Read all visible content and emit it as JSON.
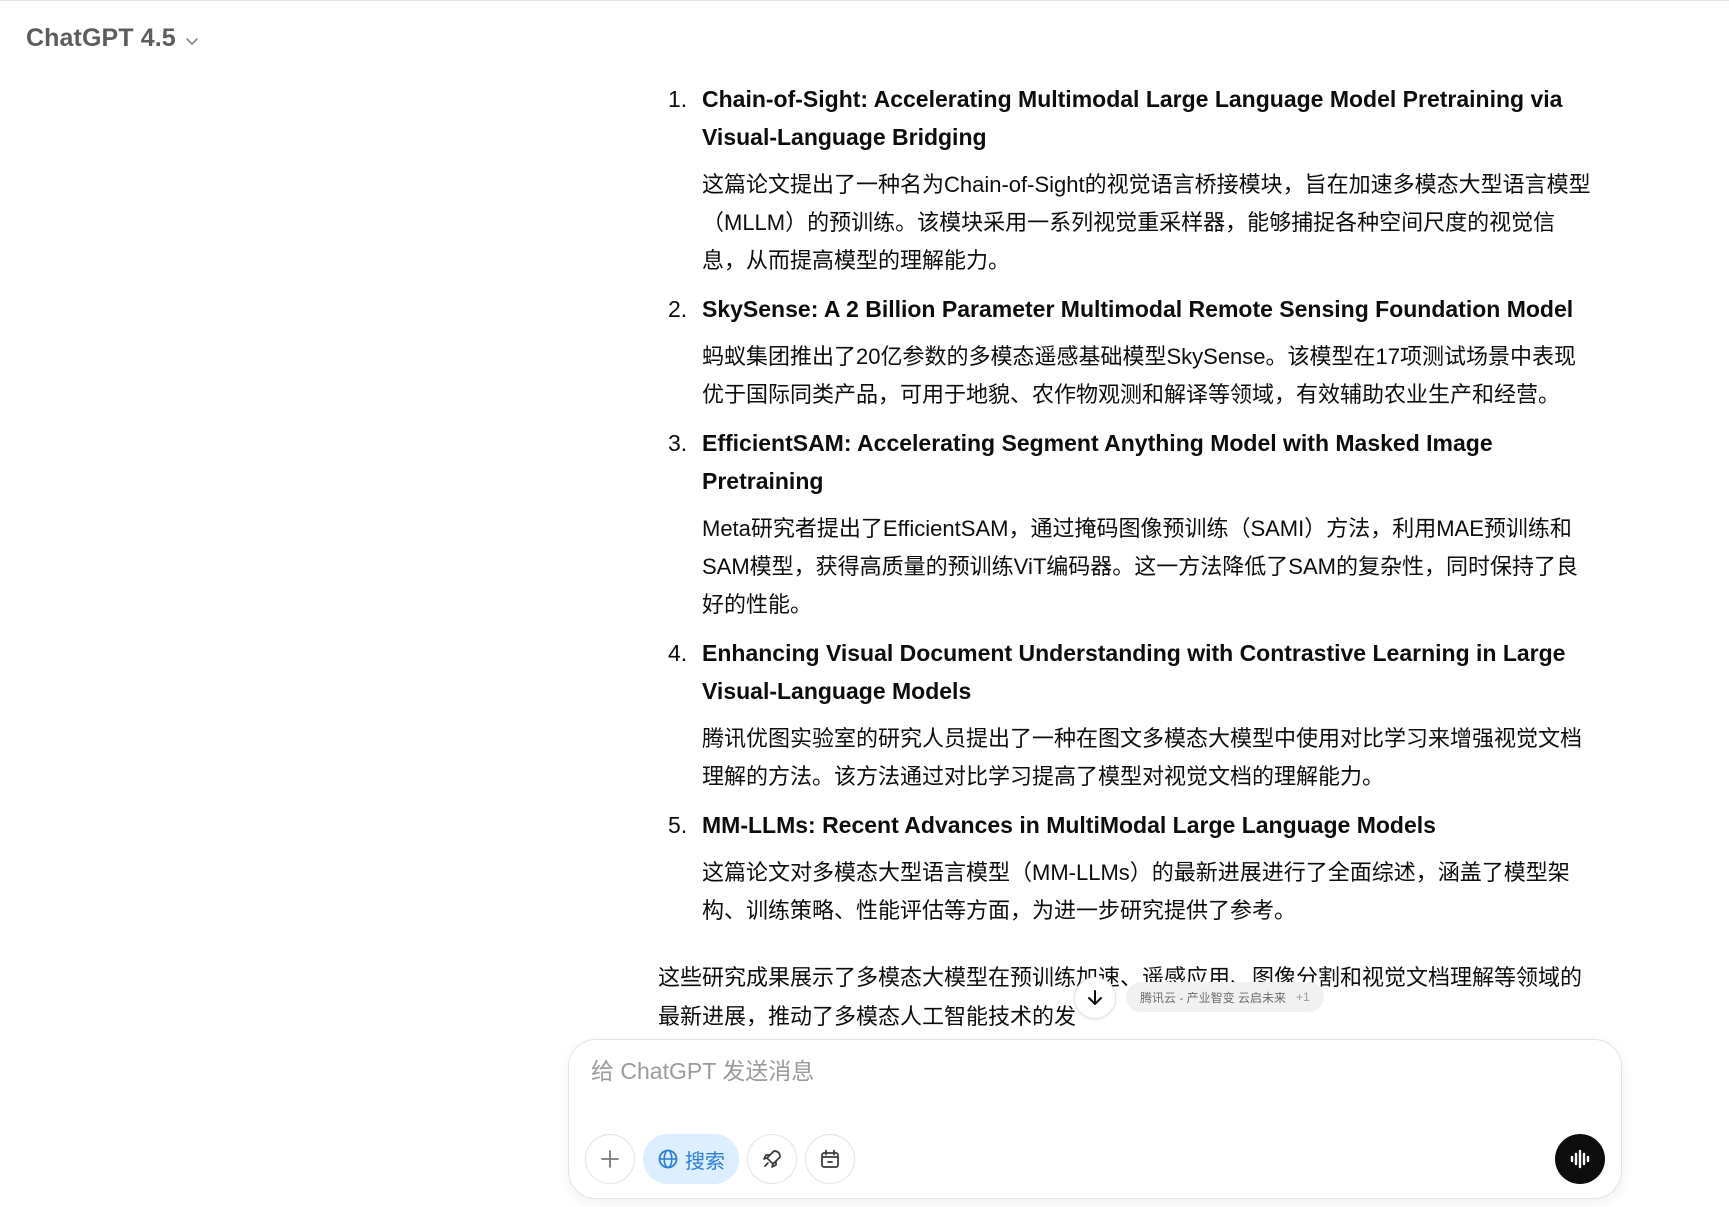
{
  "header": {
    "model_name": "ChatGPT 4.5",
    "chevron_icon": "chevron-down-icon"
  },
  "papers": [
    {
      "number": "1.",
      "title": "Chain-of-Sight: Accelerating Multimodal Large Language Model Pretraining via Visual-Language Bridging",
      "description": "这篇论文提出了一种名为Chain-of-Sight的视觉语言桥接模块，旨在加速多模态大型语言模型（MLLM）的预训练。该模块采用一系列视觉重采样器，能够捕捉各种空间尺度的视觉信息，从而提高模型的理解能力。"
    },
    {
      "number": "2.",
      "title": "SkySense: A 2 Billion Parameter Multimodal Remote Sensing Foundation Model",
      "description": "蚂蚁集团推出了20亿参数的多模态遥感基础模型SkySense。该模型在17项测试场景中表现优于国际同类产品，可用于地貌、农作物观测和解译等领域，有效辅助农业生产和经营。"
    },
    {
      "number": "3.",
      "title": "EfficientSAM: Accelerating Segment Anything Model with Masked Image Pretraining",
      "description": "Meta研究者提出了EfficientSAM，通过掩码图像预训练（SAMI）方法，利用MAE预训练和SAM模型，获得高质量的预训练ViT编码器。这一方法降低了SAM的复杂性，同时保持了良好的性能。"
    },
    {
      "number": "4.",
      "title": "Enhancing Visual Document Understanding with Contrastive Learning in Large Visual-Language Models",
      "description": "腾讯优图实验室的研究人员提出了一种在图文多模态大模型中使用对比学习来增强视觉文档理解的方法。该方法通过对比学习提高了模型对视觉文档的理解能力。"
    },
    {
      "number": "5.",
      "title": "MM-LLMs: Recent Advances in MultiModal Large Language Models",
      "description": "这篇论文对多模态大型语言模型（MM-LLMs）的最新进展进行了全面综述，涵盖了模型架构、训练策略、性能评估等方面，为进一步研究提供了参考。"
    }
  ],
  "summary": "这些研究成果展示了多模态大模型在预训练加速、遥感应用、图像分割和视觉文档理解等领域的最新进展，推动了多模态人工智能技术的发",
  "source_chip": {
    "label": "腾讯云 - 产业智变 云启未来",
    "more": "+1"
  },
  "scroll_button": {
    "icon": "arrow-down-icon"
  },
  "composer": {
    "placeholder": "给 ChatGPT 发送消息",
    "value": "",
    "search_label": "搜索",
    "icons": [
      "plus-icon",
      "globe-icon",
      "rocket-icon",
      "calendar-icon",
      "voice-icon"
    ]
  }
}
